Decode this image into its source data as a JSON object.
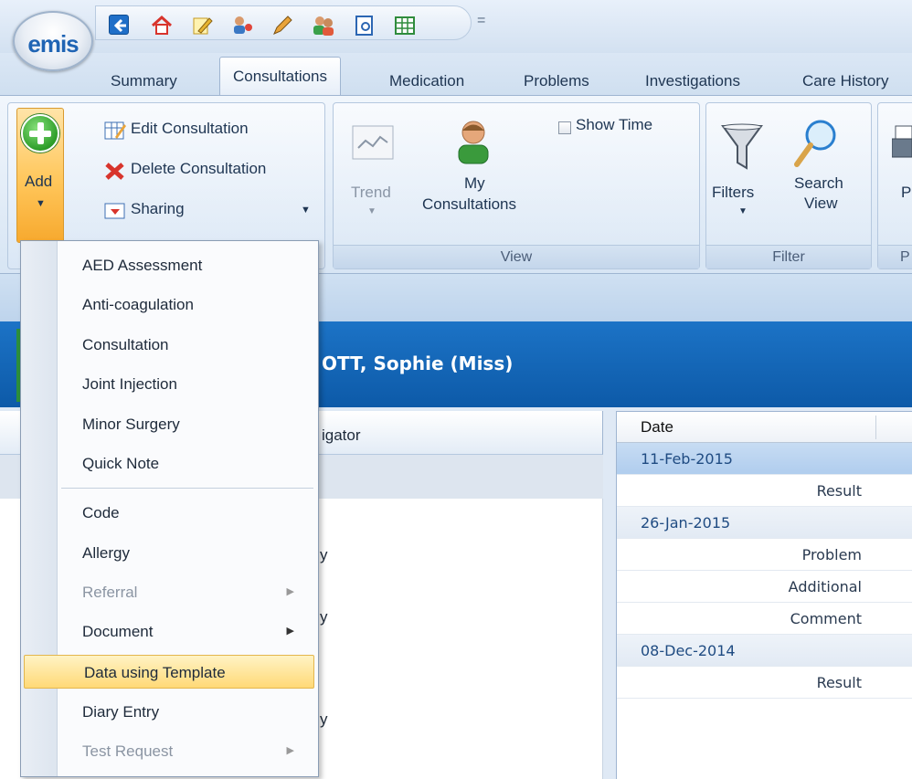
{
  "app": {
    "logo_text": "emis"
  },
  "quick_access": {
    "icons": [
      "back-arrow-icon",
      "home-icon",
      "edit-icon",
      "users-icon",
      "pen-icon",
      "people-icon",
      "document-icon",
      "grid-icon"
    ],
    "dropdown": "="
  },
  "tabs": [
    {
      "label": "Summary",
      "active": false
    },
    {
      "label": "Consultations",
      "active": true
    },
    {
      "label": "Medication",
      "active": false
    },
    {
      "label": "Problems",
      "active": false
    },
    {
      "label": "Investigations",
      "active": false
    },
    {
      "label": "Care History",
      "active": false
    }
  ],
  "ribbon": {
    "add_label": "Add",
    "edit_consultation": "Edit Consultation",
    "delete_consultation": "Delete Consultation",
    "sharing": "Sharing",
    "trend": "Trend",
    "my_consultations_line1": "My",
    "my_consultations_line2": "Consultations",
    "show_time": "Show Time",
    "view_group": "View",
    "filters": "Filters",
    "search_view_line1": "Search",
    "search_view_line2": "View",
    "filter_group": "Filter",
    "p_label": "P",
    "p_group": "P"
  },
  "add_menu": {
    "items": [
      {
        "label": "AED Assessment",
        "disabled": false,
        "submenu": false
      },
      {
        "label": "Anti-coagulation",
        "disabled": false,
        "submenu": false
      },
      {
        "label": "Consultation",
        "disabled": false,
        "submenu": false
      },
      {
        "label": "Joint Injection",
        "disabled": false,
        "submenu": false
      },
      {
        "label": "Minor Surgery",
        "disabled": false,
        "submenu": false
      },
      {
        "label": "Quick Note",
        "disabled": false,
        "submenu": false
      },
      {
        "label": "Code",
        "disabled": false,
        "submenu": false
      },
      {
        "label": "Allergy",
        "disabled": false,
        "submenu": false
      },
      {
        "label": "Referral",
        "disabled": true,
        "submenu": true
      },
      {
        "label": "Document",
        "disabled": false,
        "submenu": true
      },
      {
        "label": "Data using Template",
        "disabled": false,
        "submenu": false,
        "highlighted": true
      },
      {
        "label": "Diary Entry",
        "disabled": false,
        "submenu": false
      },
      {
        "label": "Test Request",
        "disabled": true,
        "submenu": true
      }
    ]
  },
  "patient": {
    "name": "OTT, Sophie (Miss)"
  },
  "navigator": {
    "header": "igator",
    "row_chars": [
      "y",
      "y",
      "y"
    ]
  },
  "table": {
    "header": "Date",
    "rows": [
      {
        "text": "11-Feb-2015",
        "kind": "date",
        "selected": true
      },
      {
        "text": "Result",
        "kind": "sub"
      },
      {
        "text": "26-Jan-2015",
        "kind": "date"
      },
      {
        "text": "Problem",
        "kind": "sub"
      },
      {
        "text": "Additional",
        "kind": "sub"
      },
      {
        "text": "Comment",
        "kind": "sub"
      },
      {
        "text": "08-Dec-2014",
        "kind": "date"
      },
      {
        "text": "Result",
        "kind": "sub"
      }
    ]
  },
  "colors": {
    "accent": "#0d5aa8",
    "highlight": "#ffd977",
    "add_green": "#2e9e2a"
  }
}
